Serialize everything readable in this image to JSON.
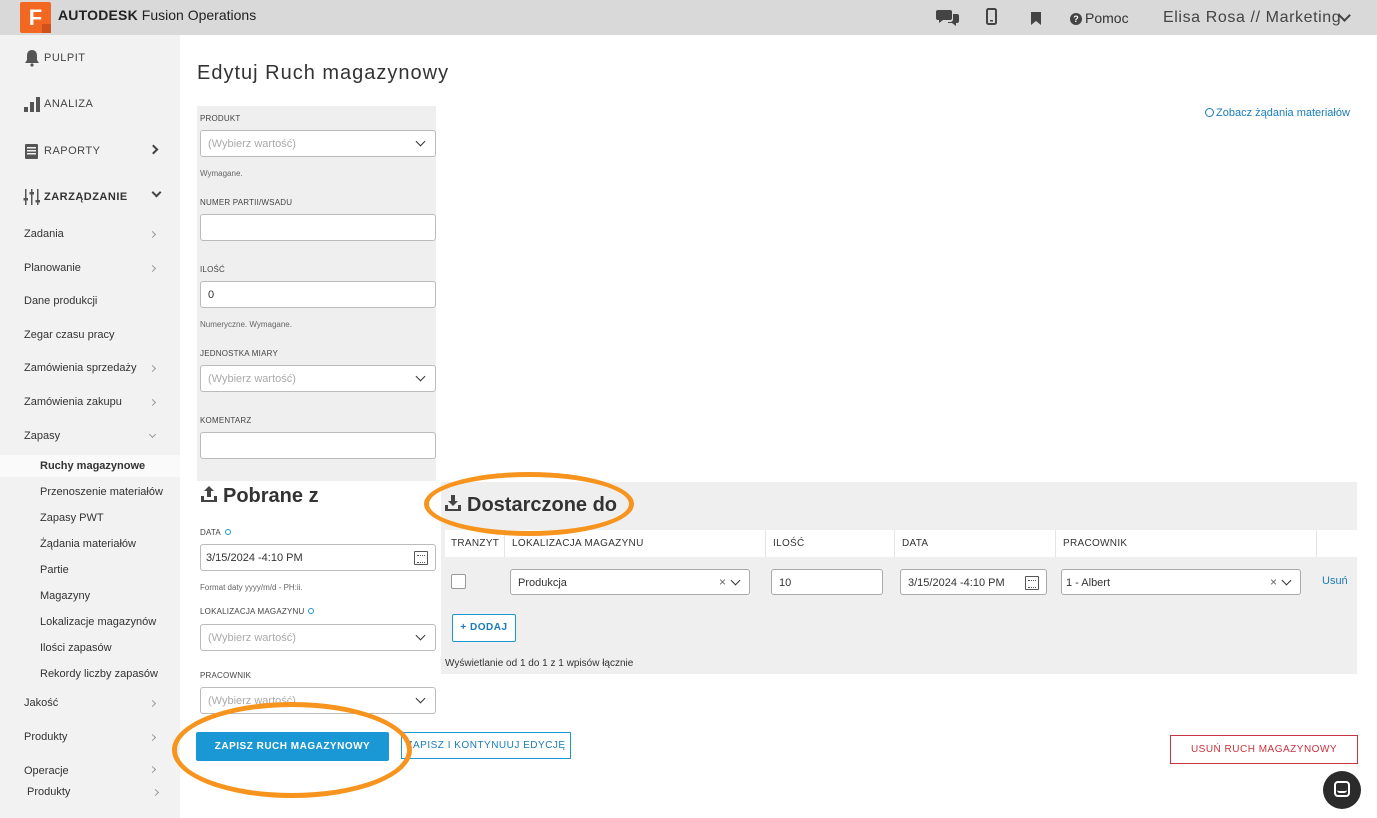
{
  "topbar": {
    "logo_letter": "F",
    "brand_bold": "AUTODESK",
    "brand_rest": "Fusion Operations",
    "help_label": "Pomoc",
    "user_label": "Elisa Rosa // Marketing",
    "icons": [
      "chat-icon",
      "mobile-icon",
      "bookmark-icon",
      "help-icon",
      "chevron-down-icon"
    ]
  },
  "sidebar": {
    "main": [
      {
        "label": "PULPIT",
        "icon": "bell-icon"
      },
      {
        "label": "ANALIZA",
        "icon": "bar-chart-icon"
      },
      {
        "label": "RAPORTY",
        "icon": "report-icon"
      },
      {
        "label": "ZARZĄDZANIE",
        "icon": "sliders-icon"
      }
    ],
    "sub": [
      {
        "label": "Zadania"
      },
      {
        "label": "Planowanie"
      },
      {
        "label": "Dane produkcji"
      },
      {
        "label": "Zegar czasu pracy"
      },
      {
        "label": "Zamówienia sprzedaży"
      },
      {
        "label": "Zamówienia zakupu"
      },
      {
        "label": "Zapasy"
      }
    ],
    "zapasy_items": [
      {
        "label": "Ruchy magazynowe"
      },
      {
        "label": "Przenoszenie materiałów"
      },
      {
        "label": "Zapasy PWT"
      },
      {
        "label": "Żądania materiałów"
      },
      {
        "label": "Partie"
      },
      {
        "label": "Magazyny"
      },
      {
        "label": "Lokalizacje magazynów"
      },
      {
        "label": "Ilości zapasów"
      },
      {
        "label": "Rekordy liczby zapasów"
      }
    ],
    "after": [
      {
        "label": "Jakość"
      },
      {
        "label": "Produkty"
      },
      {
        "label": "Operacje"
      },
      {
        "label": "Produkty"
      }
    ]
  },
  "page": {
    "title": "Edytuj Ruch magazynowy",
    "requests_link": "Zobacz żądania materiałów"
  },
  "form": {
    "product_label": "PRODUKT",
    "product_placeholder": "(Wybierz wartość)",
    "product_hint": "Wymagane.",
    "batch_label": "NUMER PARTII/WSADU",
    "batch_value": "",
    "qty_label": "ILOŚĆ",
    "qty_value": "0",
    "qty_hint": "Numeryczne. Wymagane.",
    "uom_label": "JEDNOSTKA MIARY",
    "uom_placeholder": "(Wybierz wartość)",
    "comment_label": "KOMENTARZ",
    "comment_value": ""
  },
  "taken_from": {
    "heading": "Pobrane z",
    "date_label": "DATA",
    "date_value": "3/15/2024 -4:10 PM",
    "date_hint": "Format daty yyyy/m/d - PH:ii.",
    "location_label": "LOKALIZACJA MAGAZYNU",
    "location_placeholder": "(Wybierz wartość)",
    "worker_label": "PRACOWNIK",
    "worker_placeholder": "(Wybierz wartość)"
  },
  "delivered_to": {
    "heading": "Dostarczone do",
    "columns": [
      "TRANZYT",
      "LOKALIZACJA MAGAZYNU",
      "ILOŚĆ",
      "DATA",
      "PRACOWNIK"
    ],
    "row": {
      "transit": false,
      "location": "Produkcja",
      "qty": "10",
      "date": "3/15/2024 -4:10 PM",
      "worker": "1 - Albert",
      "remove_label": "Usuń"
    },
    "add_label": "DODAJ",
    "showing": "Wyświetlanie od 1 do 1 z 1 wpisów łącznie"
  },
  "actions": {
    "save": "ZAPISZ RUCH MAGAZYNOWY",
    "save_continue": "ZAPISZ I KONTYNUUJ EDYCJĘ",
    "delete": "USUŃ RUCH MAGAZYNOWY"
  },
  "colors": {
    "accent": "#1a98d5",
    "brand": "#f26722",
    "danger": "#c9323f",
    "annotation": "#f7941d"
  }
}
